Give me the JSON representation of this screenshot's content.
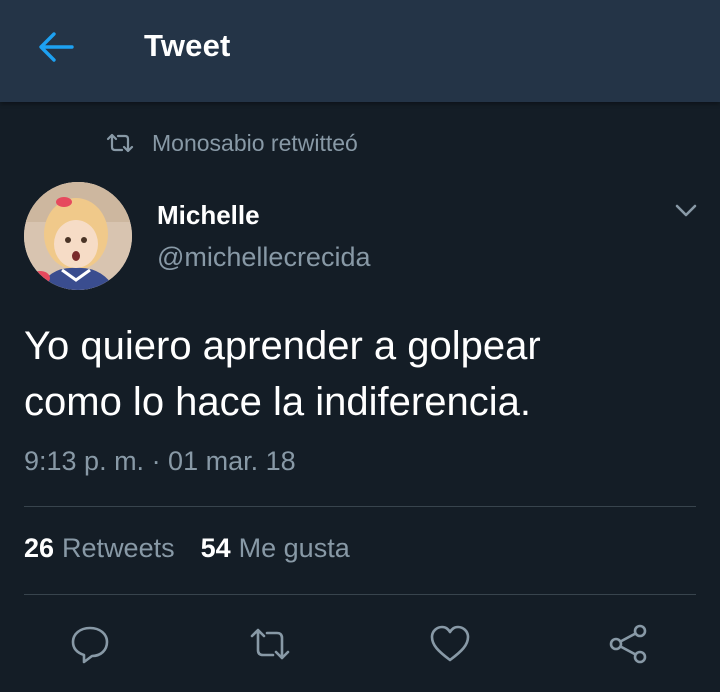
{
  "header": {
    "title": "Tweet",
    "back_icon": "arrow-left-icon"
  },
  "retweet_context": {
    "icon": "retweet-icon",
    "text": "Monosabio retwitteó"
  },
  "author": {
    "name": "Michelle",
    "handle": "@michellecrecida",
    "avatar": "avatar-image",
    "menu_icon": "chevron-down-icon"
  },
  "tweet": {
    "text": "Yo quiero aprender a golpear\ncomo lo hace la indiferencia.",
    "timestamp": "9:13 p. m. · 01 mar. 18"
  },
  "stats": {
    "retweets_count": "26",
    "retweets_label": "Retweets",
    "likes_count": "54",
    "likes_label": "Me gusta"
  },
  "actions": [
    "reply-icon",
    "retweet-icon",
    "heart-icon",
    "share-icon"
  ],
  "colors": {
    "background": "#141d26",
    "header": "#243447",
    "accent": "#1da1f2",
    "secondary_text": "#8899a6",
    "divider": "#38444d",
    "text": "#ffffff"
  }
}
